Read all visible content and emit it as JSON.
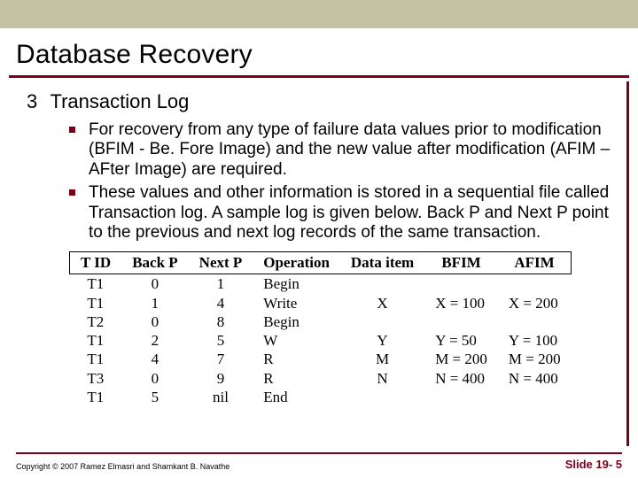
{
  "title": "Database Recovery",
  "item_number": "3",
  "item_label": "Transaction Log",
  "bullets": [
    "For recovery from any type of failure data values prior to modification (BFIM - Be. Fore Image) and the new value after modification (AFIM – AFter Image) are required.",
    "These values and other information is stored in a sequential file called Transaction log.  A sample log is given below. Back P and Next P point to the previous and next log records of the same transaction."
  ],
  "chart_data": {
    "type": "table",
    "headers": [
      "T ID",
      "Back P",
      "Next P",
      "Operation",
      "Data item",
      "BFIM",
      "AFIM"
    ],
    "rows": [
      [
        "T1",
        "0",
        "1",
        "Begin",
        "",
        "",
        ""
      ],
      [
        "T1",
        "1",
        "4",
        "Write",
        "X",
        "X = 100",
        "X = 200"
      ],
      [
        "T2",
        "0",
        "8",
        "Begin",
        "",
        "",
        ""
      ],
      [
        "T1",
        "2",
        "5",
        "W",
        "Y",
        "Y = 50",
        "Y = 100"
      ],
      [
        "T1",
        "4",
        "7",
        "R",
        "M",
        "M = 200",
        "M = 200"
      ],
      [
        "T3",
        "0",
        "9",
        "R",
        "N",
        "N = 400",
        "N = 400"
      ],
      [
        "T1",
        "5",
        "nil",
        "End",
        "",
        "",
        ""
      ]
    ]
  },
  "footer": {
    "copyright": "Copyright © 2007 Ramez Elmasri and Shamkant B. Navathe",
    "slide": "Slide 19- 5"
  }
}
